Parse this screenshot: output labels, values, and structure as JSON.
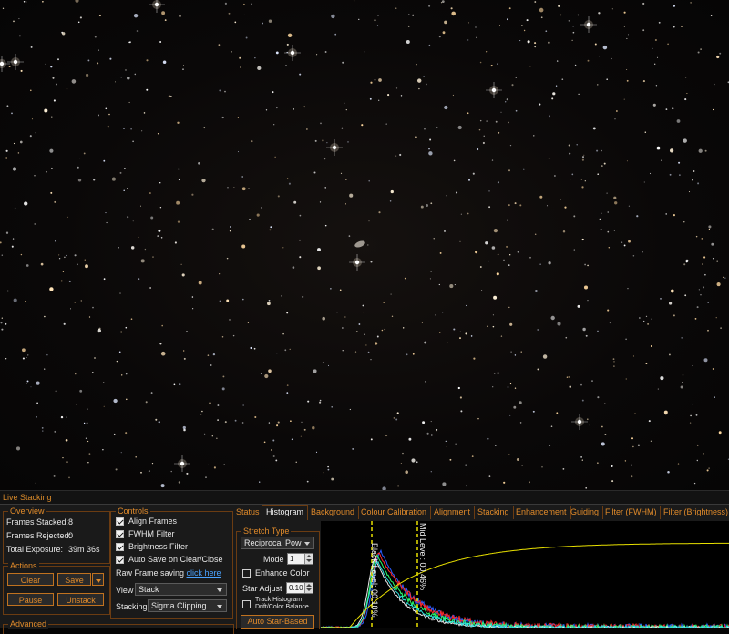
{
  "window": {
    "title": "Live Stacking"
  },
  "overview": {
    "title": "Overview",
    "rows": [
      {
        "label": "Frames Stacked:",
        "value": "8"
      },
      {
        "label": "Frames Rejected:",
        "value": "0"
      },
      {
        "label": "Total Exposure:",
        "value": "39m 36s"
      }
    ]
  },
  "actions": {
    "title": "Actions",
    "clear": "Clear",
    "save": "Save",
    "pause": "Pause",
    "unstack": "Unstack"
  },
  "advanced": {
    "title": "Advanced"
  },
  "controls": {
    "title": "Controls",
    "checks": [
      {
        "label": "Align Frames",
        "checked": true
      },
      {
        "label": "FWHM Filter",
        "checked": true
      },
      {
        "label": "Brightness Filter",
        "checked": true
      },
      {
        "label": "Auto Save on Clear/Close",
        "checked": true
      }
    ],
    "raw_label": "Raw Frame saving",
    "raw_link": "click here",
    "view_label": "View",
    "view_value": "Stack",
    "stacking_label": "Stacking",
    "stacking_value": "Sigma Clipping"
  },
  "tabs": [
    "Status",
    "Histogram",
    "Background",
    "Colour Calibration",
    "Alignment",
    "Stacking",
    "Enhancement",
    "Guiding",
    "Filter (FWHM)",
    "Filter (Brightness)"
  ],
  "active_tab": "Histogram",
  "stretch": {
    "title": "Stretch Type",
    "type_value": "Reciprocal Pow",
    "mode_label": "Mode",
    "mode_value": "1",
    "enhance_label": "Enhance Color",
    "star_adjust_label": "Star Adjust",
    "star_adjust_value": "0.10",
    "track_line1": "Track Histogram",
    "track_line2": "Drift/Color Balance",
    "auto_button": "Auto Star-Based"
  },
  "histogram": {
    "black_label": "Black Level: 00.18%",
    "mid_label": "Mid Level: 00.46%"
  },
  "colors": {
    "accent": "#e08a2a",
    "border": "#6b3c12",
    "link": "#4aa3ff",
    "marker": "#e8e000"
  }
}
